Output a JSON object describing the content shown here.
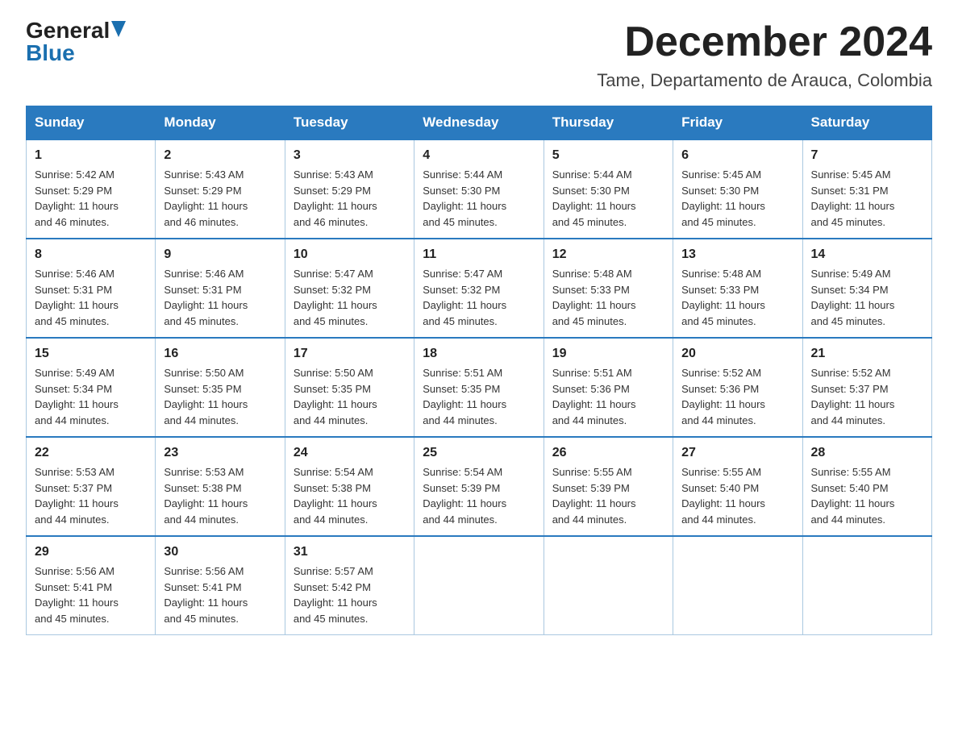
{
  "logo": {
    "general": "General",
    "blue": "Blue",
    "triangle": "▲"
  },
  "header": {
    "month_year": "December 2024",
    "location": "Tame, Departamento de Arauca, Colombia"
  },
  "days_of_week": [
    "Sunday",
    "Monday",
    "Tuesday",
    "Wednesday",
    "Thursday",
    "Friday",
    "Saturday"
  ],
  "weeks": [
    [
      {
        "day": "1",
        "sunrise": "5:42 AM",
        "sunset": "5:29 PM",
        "daylight": "11 hours and 46 minutes."
      },
      {
        "day": "2",
        "sunrise": "5:43 AM",
        "sunset": "5:29 PM",
        "daylight": "11 hours and 46 minutes."
      },
      {
        "day": "3",
        "sunrise": "5:43 AM",
        "sunset": "5:29 PM",
        "daylight": "11 hours and 46 minutes."
      },
      {
        "day": "4",
        "sunrise": "5:44 AM",
        "sunset": "5:30 PM",
        "daylight": "11 hours and 45 minutes."
      },
      {
        "day": "5",
        "sunrise": "5:44 AM",
        "sunset": "5:30 PM",
        "daylight": "11 hours and 45 minutes."
      },
      {
        "day": "6",
        "sunrise": "5:45 AM",
        "sunset": "5:30 PM",
        "daylight": "11 hours and 45 minutes."
      },
      {
        "day": "7",
        "sunrise": "5:45 AM",
        "sunset": "5:31 PM",
        "daylight": "11 hours and 45 minutes."
      }
    ],
    [
      {
        "day": "8",
        "sunrise": "5:46 AM",
        "sunset": "5:31 PM",
        "daylight": "11 hours and 45 minutes."
      },
      {
        "day": "9",
        "sunrise": "5:46 AM",
        "sunset": "5:31 PM",
        "daylight": "11 hours and 45 minutes."
      },
      {
        "day": "10",
        "sunrise": "5:47 AM",
        "sunset": "5:32 PM",
        "daylight": "11 hours and 45 minutes."
      },
      {
        "day": "11",
        "sunrise": "5:47 AM",
        "sunset": "5:32 PM",
        "daylight": "11 hours and 45 minutes."
      },
      {
        "day": "12",
        "sunrise": "5:48 AM",
        "sunset": "5:33 PM",
        "daylight": "11 hours and 45 minutes."
      },
      {
        "day": "13",
        "sunrise": "5:48 AM",
        "sunset": "5:33 PM",
        "daylight": "11 hours and 45 minutes."
      },
      {
        "day": "14",
        "sunrise": "5:49 AM",
        "sunset": "5:34 PM",
        "daylight": "11 hours and 45 minutes."
      }
    ],
    [
      {
        "day": "15",
        "sunrise": "5:49 AM",
        "sunset": "5:34 PM",
        "daylight": "11 hours and 44 minutes."
      },
      {
        "day": "16",
        "sunrise": "5:50 AM",
        "sunset": "5:35 PM",
        "daylight": "11 hours and 44 minutes."
      },
      {
        "day": "17",
        "sunrise": "5:50 AM",
        "sunset": "5:35 PM",
        "daylight": "11 hours and 44 minutes."
      },
      {
        "day": "18",
        "sunrise": "5:51 AM",
        "sunset": "5:35 PM",
        "daylight": "11 hours and 44 minutes."
      },
      {
        "day": "19",
        "sunrise": "5:51 AM",
        "sunset": "5:36 PM",
        "daylight": "11 hours and 44 minutes."
      },
      {
        "day": "20",
        "sunrise": "5:52 AM",
        "sunset": "5:36 PM",
        "daylight": "11 hours and 44 minutes."
      },
      {
        "day": "21",
        "sunrise": "5:52 AM",
        "sunset": "5:37 PM",
        "daylight": "11 hours and 44 minutes."
      }
    ],
    [
      {
        "day": "22",
        "sunrise": "5:53 AM",
        "sunset": "5:37 PM",
        "daylight": "11 hours and 44 minutes."
      },
      {
        "day": "23",
        "sunrise": "5:53 AM",
        "sunset": "5:38 PM",
        "daylight": "11 hours and 44 minutes."
      },
      {
        "day": "24",
        "sunrise": "5:54 AM",
        "sunset": "5:38 PM",
        "daylight": "11 hours and 44 minutes."
      },
      {
        "day": "25",
        "sunrise": "5:54 AM",
        "sunset": "5:39 PM",
        "daylight": "11 hours and 44 minutes."
      },
      {
        "day": "26",
        "sunrise": "5:55 AM",
        "sunset": "5:39 PM",
        "daylight": "11 hours and 44 minutes."
      },
      {
        "day": "27",
        "sunrise": "5:55 AM",
        "sunset": "5:40 PM",
        "daylight": "11 hours and 44 minutes."
      },
      {
        "day": "28",
        "sunrise": "5:55 AM",
        "sunset": "5:40 PM",
        "daylight": "11 hours and 44 minutes."
      }
    ],
    [
      {
        "day": "29",
        "sunrise": "5:56 AM",
        "sunset": "5:41 PM",
        "daylight": "11 hours and 45 minutes."
      },
      {
        "day": "30",
        "sunrise": "5:56 AM",
        "sunset": "5:41 PM",
        "daylight": "11 hours and 45 minutes."
      },
      {
        "day": "31",
        "sunrise": "5:57 AM",
        "sunset": "5:42 PM",
        "daylight": "11 hours and 45 minutes."
      },
      null,
      null,
      null,
      null
    ]
  ],
  "labels": {
    "sunrise": "Sunrise:",
    "sunset": "Sunset:",
    "daylight": "Daylight:"
  }
}
